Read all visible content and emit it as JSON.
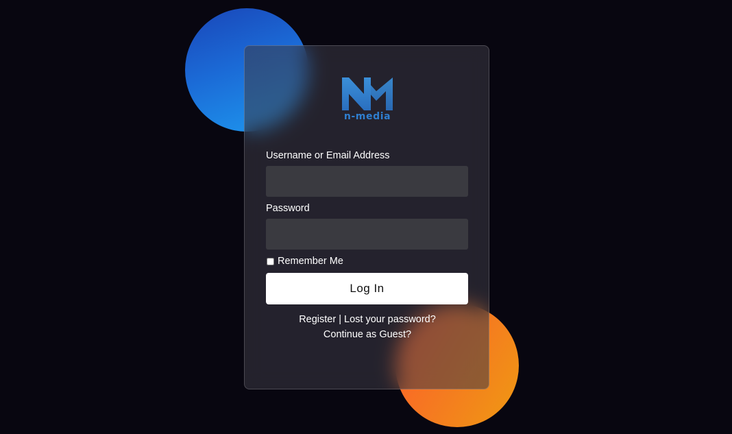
{
  "logo": {
    "text": "n-media",
    "color": "#2f7fd0"
  },
  "form": {
    "username_label": "Username or Email Address",
    "username_value": "",
    "password_label": "Password",
    "password_value": "",
    "remember_label": "Remember Me",
    "remember_checked": false,
    "login_label": "Log In"
  },
  "links": {
    "register": "Register",
    "separator": "|",
    "lost_password": "Lost your password?",
    "guest": "Continue as Guest?"
  },
  "colors": {
    "background": "#080610",
    "blue_orb": "#1b6ad6",
    "orange_orb": "#f57a20",
    "input_bg": "#3a3a40",
    "button_bg": "#ffffff"
  }
}
